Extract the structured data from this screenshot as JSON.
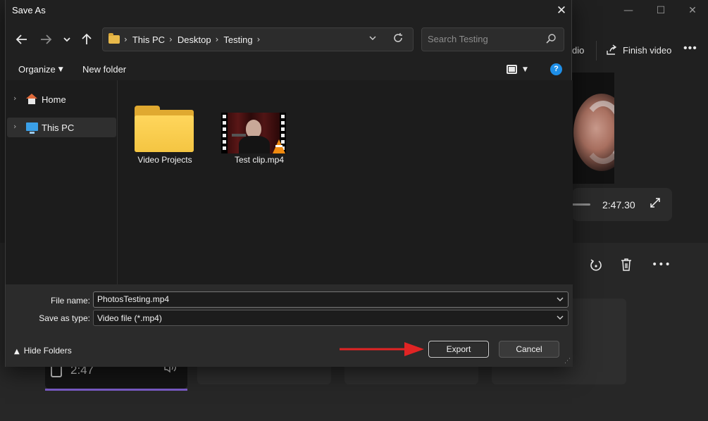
{
  "background_app": {
    "tool_audio_label": "dio",
    "tool_finish_label": "Finish video",
    "preview_time": "2:47.30",
    "clip_duration": "2:47",
    "more_glyph": "•••",
    "window_controls": {
      "minimize": "—",
      "maximize": "☐",
      "close": "✕"
    }
  },
  "dialog": {
    "title": "Save As",
    "close_glyph": "✕",
    "breadcrumbs": [
      "This PC",
      "Desktop",
      "Testing"
    ],
    "search_placeholder": "Search Testing",
    "organize_label": "Organize",
    "new_folder_label": "New folder",
    "help_glyph": "?",
    "nav_items": [
      {
        "label": "Home",
        "icon": "home-icon"
      },
      {
        "label": "This PC",
        "icon": "this-pc-icon",
        "selected": true
      }
    ],
    "files": [
      {
        "name": "Video Projects",
        "type": "folder",
        "icon": "folder-icon"
      },
      {
        "name": "Test clip.mp4",
        "type": "video",
        "icon": "video-thumbnail"
      }
    ],
    "file_name_label": "File name:",
    "file_name_value": "PhotosTesting.mp4",
    "save_type_label": "Save as type:",
    "save_type_value": "Video file (*.mp4)",
    "hide_folders_label": "Hide Folders",
    "export_label": "Export",
    "cancel_label": "Cancel"
  },
  "colors": {
    "accent_help": "#1e8fe8",
    "folder_yellow": "#f4c542",
    "arrow_red": "#e02424",
    "timeline_accent": "#7a5bc7"
  }
}
